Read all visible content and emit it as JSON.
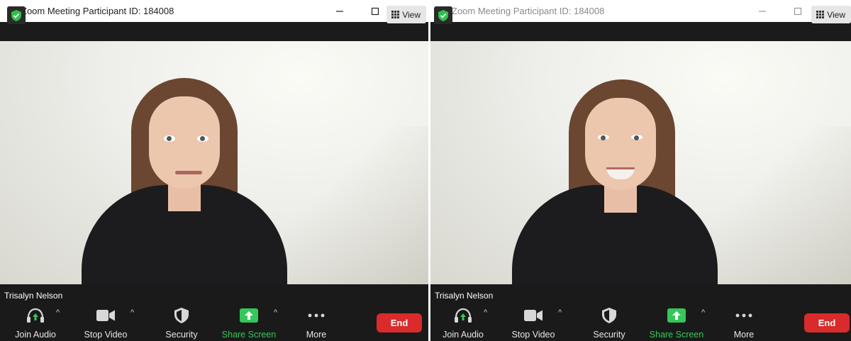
{
  "windows": [
    {
      "title": "Zoom Meeting Participant ID: 184008",
      "view_label": "View",
      "participant_name": "Trisalyn Nelson",
      "expression": "shocked",
      "toolbar": {
        "join_audio": "Join Audio",
        "stop_video": "Stop Video",
        "security": "Security",
        "share_screen": "Share Screen",
        "more": "More",
        "end": "End"
      }
    },
    {
      "title": "Zoom Meeting Participant ID: 184008",
      "view_label": "View",
      "participant_name": "Trisalyn Nelson",
      "expression": "smiling",
      "toolbar": {
        "join_audio": "Join Audio",
        "stop_video": "Stop Video",
        "security": "Security",
        "share_screen": "Share Screen",
        "more": "More",
        "end": "End"
      }
    }
  ],
  "colors": {
    "accent_blue": "#2d8cff",
    "share_green": "#35c759",
    "end_red": "#d92b2b",
    "toolbar_bg": "#1a1a1a"
  }
}
